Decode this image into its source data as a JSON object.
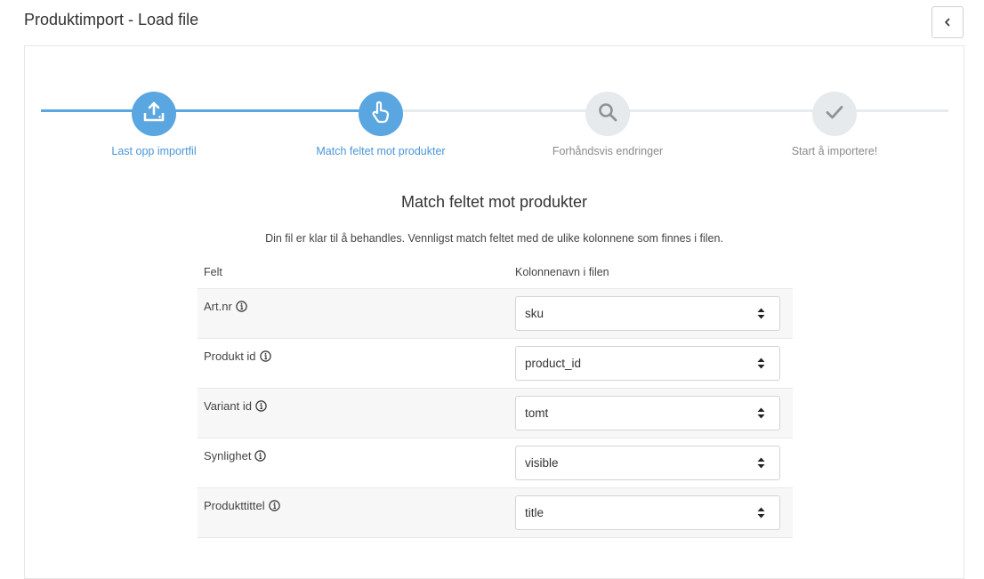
{
  "header": {
    "title": "Produktimport - Load file",
    "back_icon": "chevron-left-icon"
  },
  "steps": [
    {
      "label": "Last opp importfil",
      "icon": "upload-tray-icon",
      "state": "done"
    },
    {
      "label": "Match feltet mot produkter",
      "icon": "hand-pointer-icon",
      "state": "current"
    },
    {
      "label": "Forhåndsvis endringer",
      "icon": "search-icon",
      "state": "pending"
    },
    {
      "label": "Start å importere!",
      "icon": "checkmark-icon",
      "state": "pending"
    }
  ],
  "section": {
    "title": "Match feltet mot produkter",
    "description": "Din fil er klar til å behandles. Vennligst match feltet med de ulike kolonnene som finnes i filen."
  },
  "table": {
    "headers": {
      "field": "Felt",
      "column": "Kolonnenavn i filen"
    },
    "rows": [
      {
        "field": "Art.nr",
        "value": "sku"
      },
      {
        "field": "Produkt id",
        "value": "product_id"
      },
      {
        "field": "Variant id",
        "value": "tomt"
      },
      {
        "field": "Synlighet",
        "value": "visible"
      },
      {
        "field": "Produkttittel",
        "value": "title"
      }
    ]
  },
  "colors": {
    "accent": "#5aa6e0",
    "accent_text": "#4a96d6",
    "pending_circle": "#e6eaed",
    "pending_text": "#8a8a8a"
  }
}
